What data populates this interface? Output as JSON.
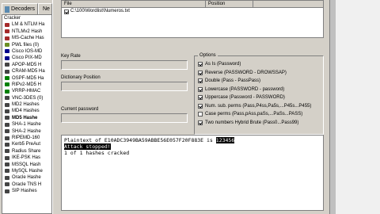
{
  "tabs": [
    {
      "label": "Decoders",
      "active": false
    },
    {
      "label": "Ne",
      "active": false
    }
  ],
  "tree": [
    {
      "label": "Cracker",
      "color": "#000000",
      "root": true
    },
    {
      "label": "LM & NTLM Ha",
      "color": "#a52a2a"
    },
    {
      "label": "NTLMv2 Hash",
      "color": "#a52a2a"
    },
    {
      "label": "MS-Cache Has",
      "color": "#a52a2a"
    },
    {
      "label": "PWL files (0)",
      "color": "#6b8e23"
    },
    {
      "label": "Cisco IOS-MD",
      "color": "#00008b"
    },
    {
      "label": "Cisco PIX-MD",
      "color": "#00008b"
    },
    {
      "label": "APOP-MD5 H",
      "color": "#444444"
    },
    {
      "label": "CRAM-MD5 Ha",
      "color": "#444444"
    },
    {
      "label": "OSPF-MD5 Ha",
      "color": "#008000"
    },
    {
      "label": "RIPv2-MD5 H",
      "color": "#008000"
    },
    {
      "label": "VRRP-HMAC",
      "color": "#008000"
    },
    {
      "label": "VNC-3DES (0)",
      "color": "#444444"
    },
    {
      "label": "MD2 Hashes",
      "color": "#444444"
    },
    {
      "label": "MD4 Hashes",
      "color": "#444444"
    },
    {
      "label": "MD5 Hashe",
      "color": "#444444",
      "selected": true
    },
    {
      "label": "SHA-1 Hashe",
      "color": "#444444"
    },
    {
      "label": "SHA-2 Hashe",
      "color": "#444444"
    },
    {
      "label": "RIPEMD-160",
      "color": "#444444"
    },
    {
      "label": "Kerb5 PreAut",
      "color": "#444444"
    },
    {
      "label": "Radius Share",
      "color": "#444444"
    },
    {
      "label": "IKE-PSK Has",
      "color": "#444444"
    },
    {
      "label": "MSSQL Hash",
      "color": "#444444"
    },
    {
      "label": "MySQL Hashe",
      "color": "#444444"
    },
    {
      "label": "Oracle Hashe",
      "color": "#444444"
    },
    {
      "label": "Oracle TNS H",
      "color": "#444444"
    },
    {
      "label": "SIP Hashes",
      "color": "#444444"
    }
  ],
  "filelist": {
    "col_file": "File",
    "col_position": "Position",
    "rows": [
      {
        "path": "C:\\100\\Wordlist\\Numeros.txt",
        "checked": true
      }
    ]
  },
  "fields": {
    "key_rate_label": "Key Rate",
    "dictionary_position_label": "Dictionary Position",
    "current_password_label": "Current password"
  },
  "options": {
    "title": "Options",
    "items": [
      {
        "label": "As Is (Password)",
        "checked": true
      },
      {
        "label": "Reverse (PASSWORD - DROWSSAP)",
        "checked": true
      },
      {
        "label": "Double (Pass - PassPass)",
        "checked": true
      },
      {
        "label": "Lowercase (PASSWORD - password)",
        "checked": true
      },
      {
        "label": "Uppercase (Password - PASSWORD)",
        "checked": true
      },
      {
        "label": "Num. sub. perms (Pass,P4ss,Pa5s,...P45s...P455)",
        "checked": true
      },
      {
        "label": "Case perms (Pass,pAss,paSs,...PaSs...PASS)",
        "checked": false
      },
      {
        "label": "Two numbers Hybrid Brute (Pass0...Pass99)",
        "checked": true
      }
    ]
  },
  "console": {
    "line1_prefix": "Plaintext of E10ADC3949BA59ABBE56E057F20F883E is ",
    "line1_value": "123456",
    "line2": "Attack stopped!",
    "line3": "1 of 1 hashes cracked"
  }
}
